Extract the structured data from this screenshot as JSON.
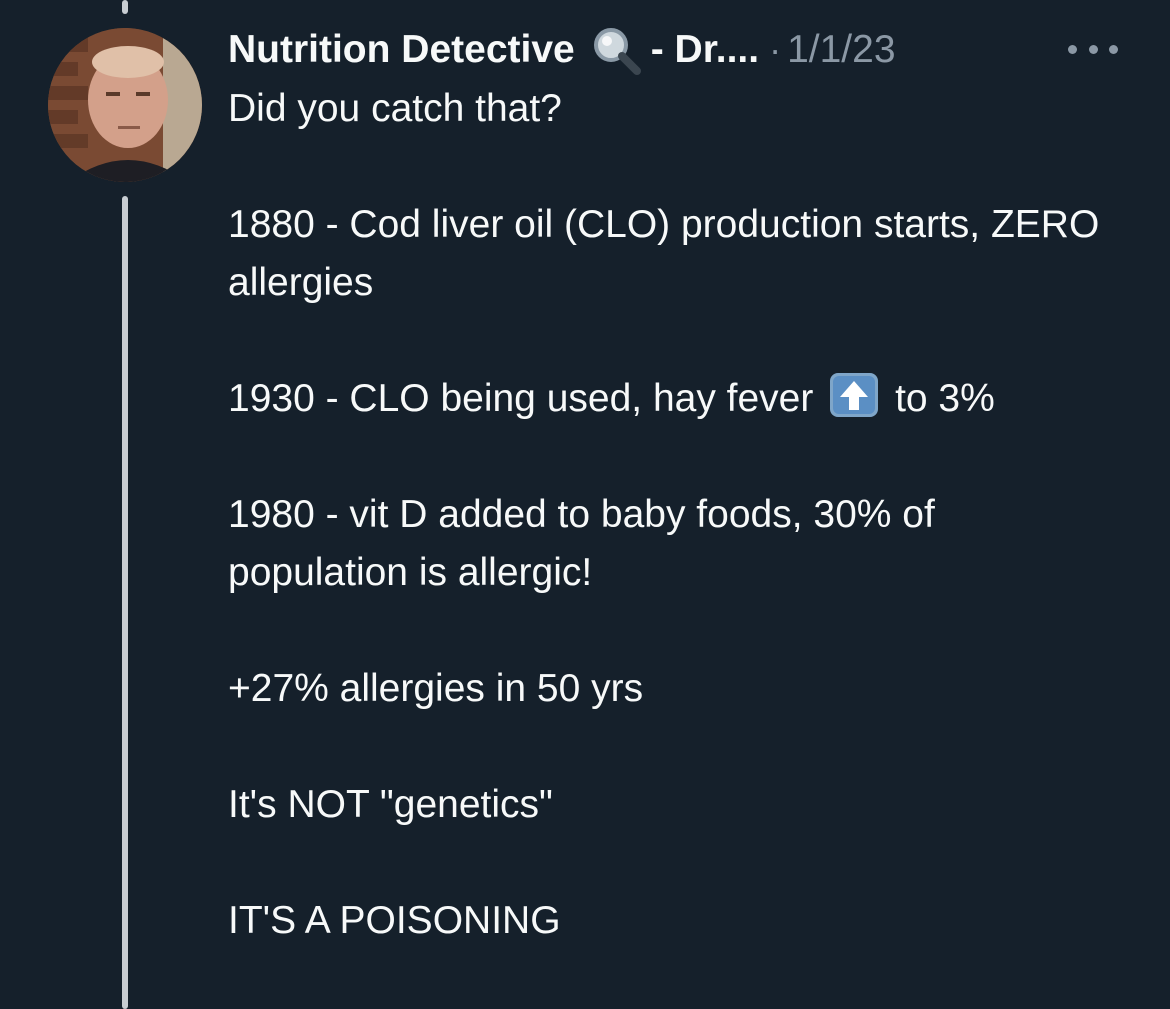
{
  "author": {
    "display_name": "Nutrition Detective",
    "name_emoji_icon": "magnifying-glass-icon",
    "name_suffix": "- Dr....",
    "separator": "·",
    "timestamp": "1/1/23"
  },
  "tweet": {
    "intro": "Did you catch that?",
    "line1": "1880 - Cod liver oil (CLO) production starts, ZERO allergies",
    "line2_before": "1930 - CLO being used, hay fever",
    "line2_emoji_icon": "up-arrow-icon",
    "line2_after": "to 3%",
    "line3": "1980 - vit D added to baby foods, 30% of population is allergic!",
    "line4": "+27% allergies in 50 yrs",
    "line5": "It's NOT \"genetics\"",
    "line6": "IT'S A POISONING"
  },
  "colors": {
    "background": "#15202b",
    "text": "#f7f9f9",
    "muted": "#8b98a5",
    "thread_line": "#c8cdd2"
  }
}
